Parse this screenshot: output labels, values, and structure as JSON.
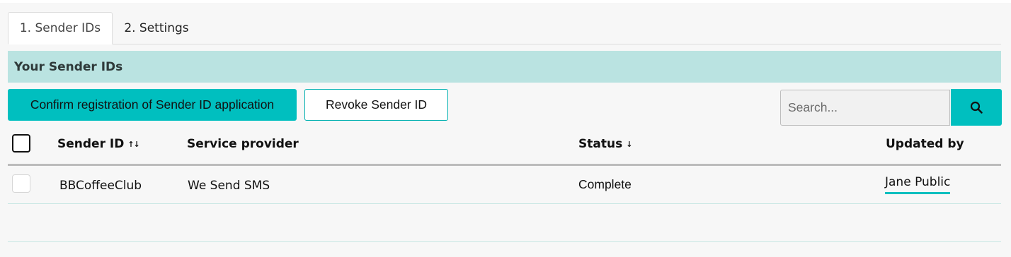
{
  "tabs": [
    {
      "label": "1. Sender IDs",
      "active": true
    },
    {
      "label": "2. Settings",
      "active": false
    }
  ],
  "section": {
    "title": "Your Sender IDs"
  },
  "toolbar": {
    "confirm_label": "Confirm registration of Sender ID application",
    "revoke_label": "Revoke Sender ID"
  },
  "search": {
    "placeholder": "Search...",
    "value": "",
    "icon": "search-icon"
  },
  "table": {
    "columns": [
      {
        "label": "Sender ID",
        "sort_icon": "↑↓"
      },
      {
        "label": "Service provider",
        "sort_icon": ""
      },
      {
        "label": "Status",
        "sort_icon": "↓"
      },
      {
        "label": "Updated by",
        "sort_icon": ""
      }
    ],
    "rows": [
      {
        "sender_id": "BBCoffeeClub",
        "service_provider": "We Send SMS",
        "status": "Complete",
        "updated_by": "Jane Public",
        "checked": false
      }
    ]
  },
  "colors": {
    "accent": "#00bfbf",
    "section_bg": "#bae3e1"
  }
}
